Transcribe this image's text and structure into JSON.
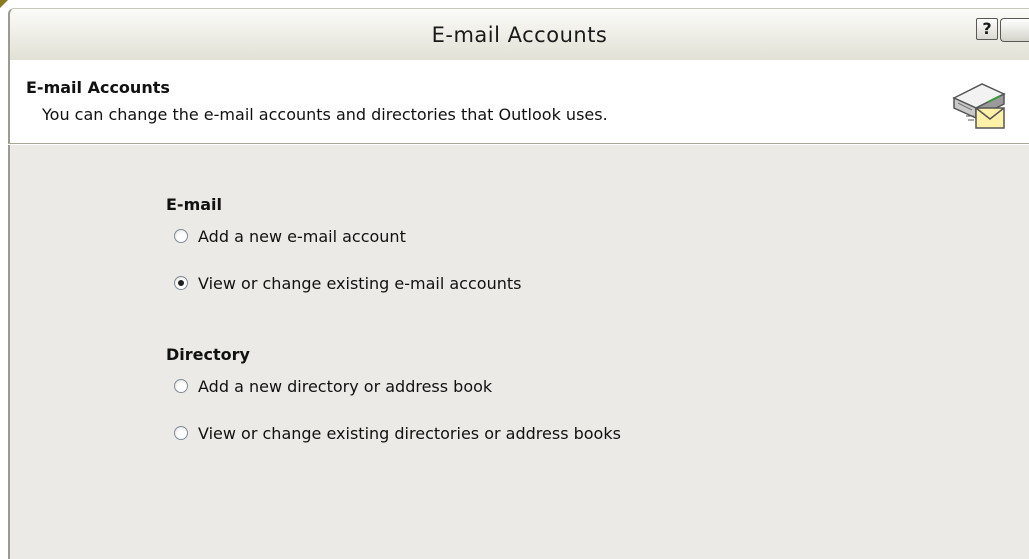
{
  "window": {
    "title": "E-mail Accounts",
    "help_label": "?"
  },
  "header": {
    "title": "E-mail Accounts",
    "description": "You can change the e-mail accounts and directories that Outlook uses.",
    "icon": "email-accounts-icon"
  },
  "groups": {
    "email": {
      "title": "E-mail",
      "options": [
        {
          "label": "Add a new e-mail account",
          "selected": false
        },
        {
          "label": "View or change existing e-mail accounts",
          "selected": true
        }
      ]
    },
    "directory": {
      "title": "Directory",
      "options": [
        {
          "label": "Add a new directory or address book",
          "selected": false
        },
        {
          "label": "View or change existing directories or address books",
          "selected": false
        }
      ]
    }
  },
  "colors": {
    "body_background": "#eceae6",
    "header_background": "#ffffff",
    "separator": "#aca899"
  }
}
